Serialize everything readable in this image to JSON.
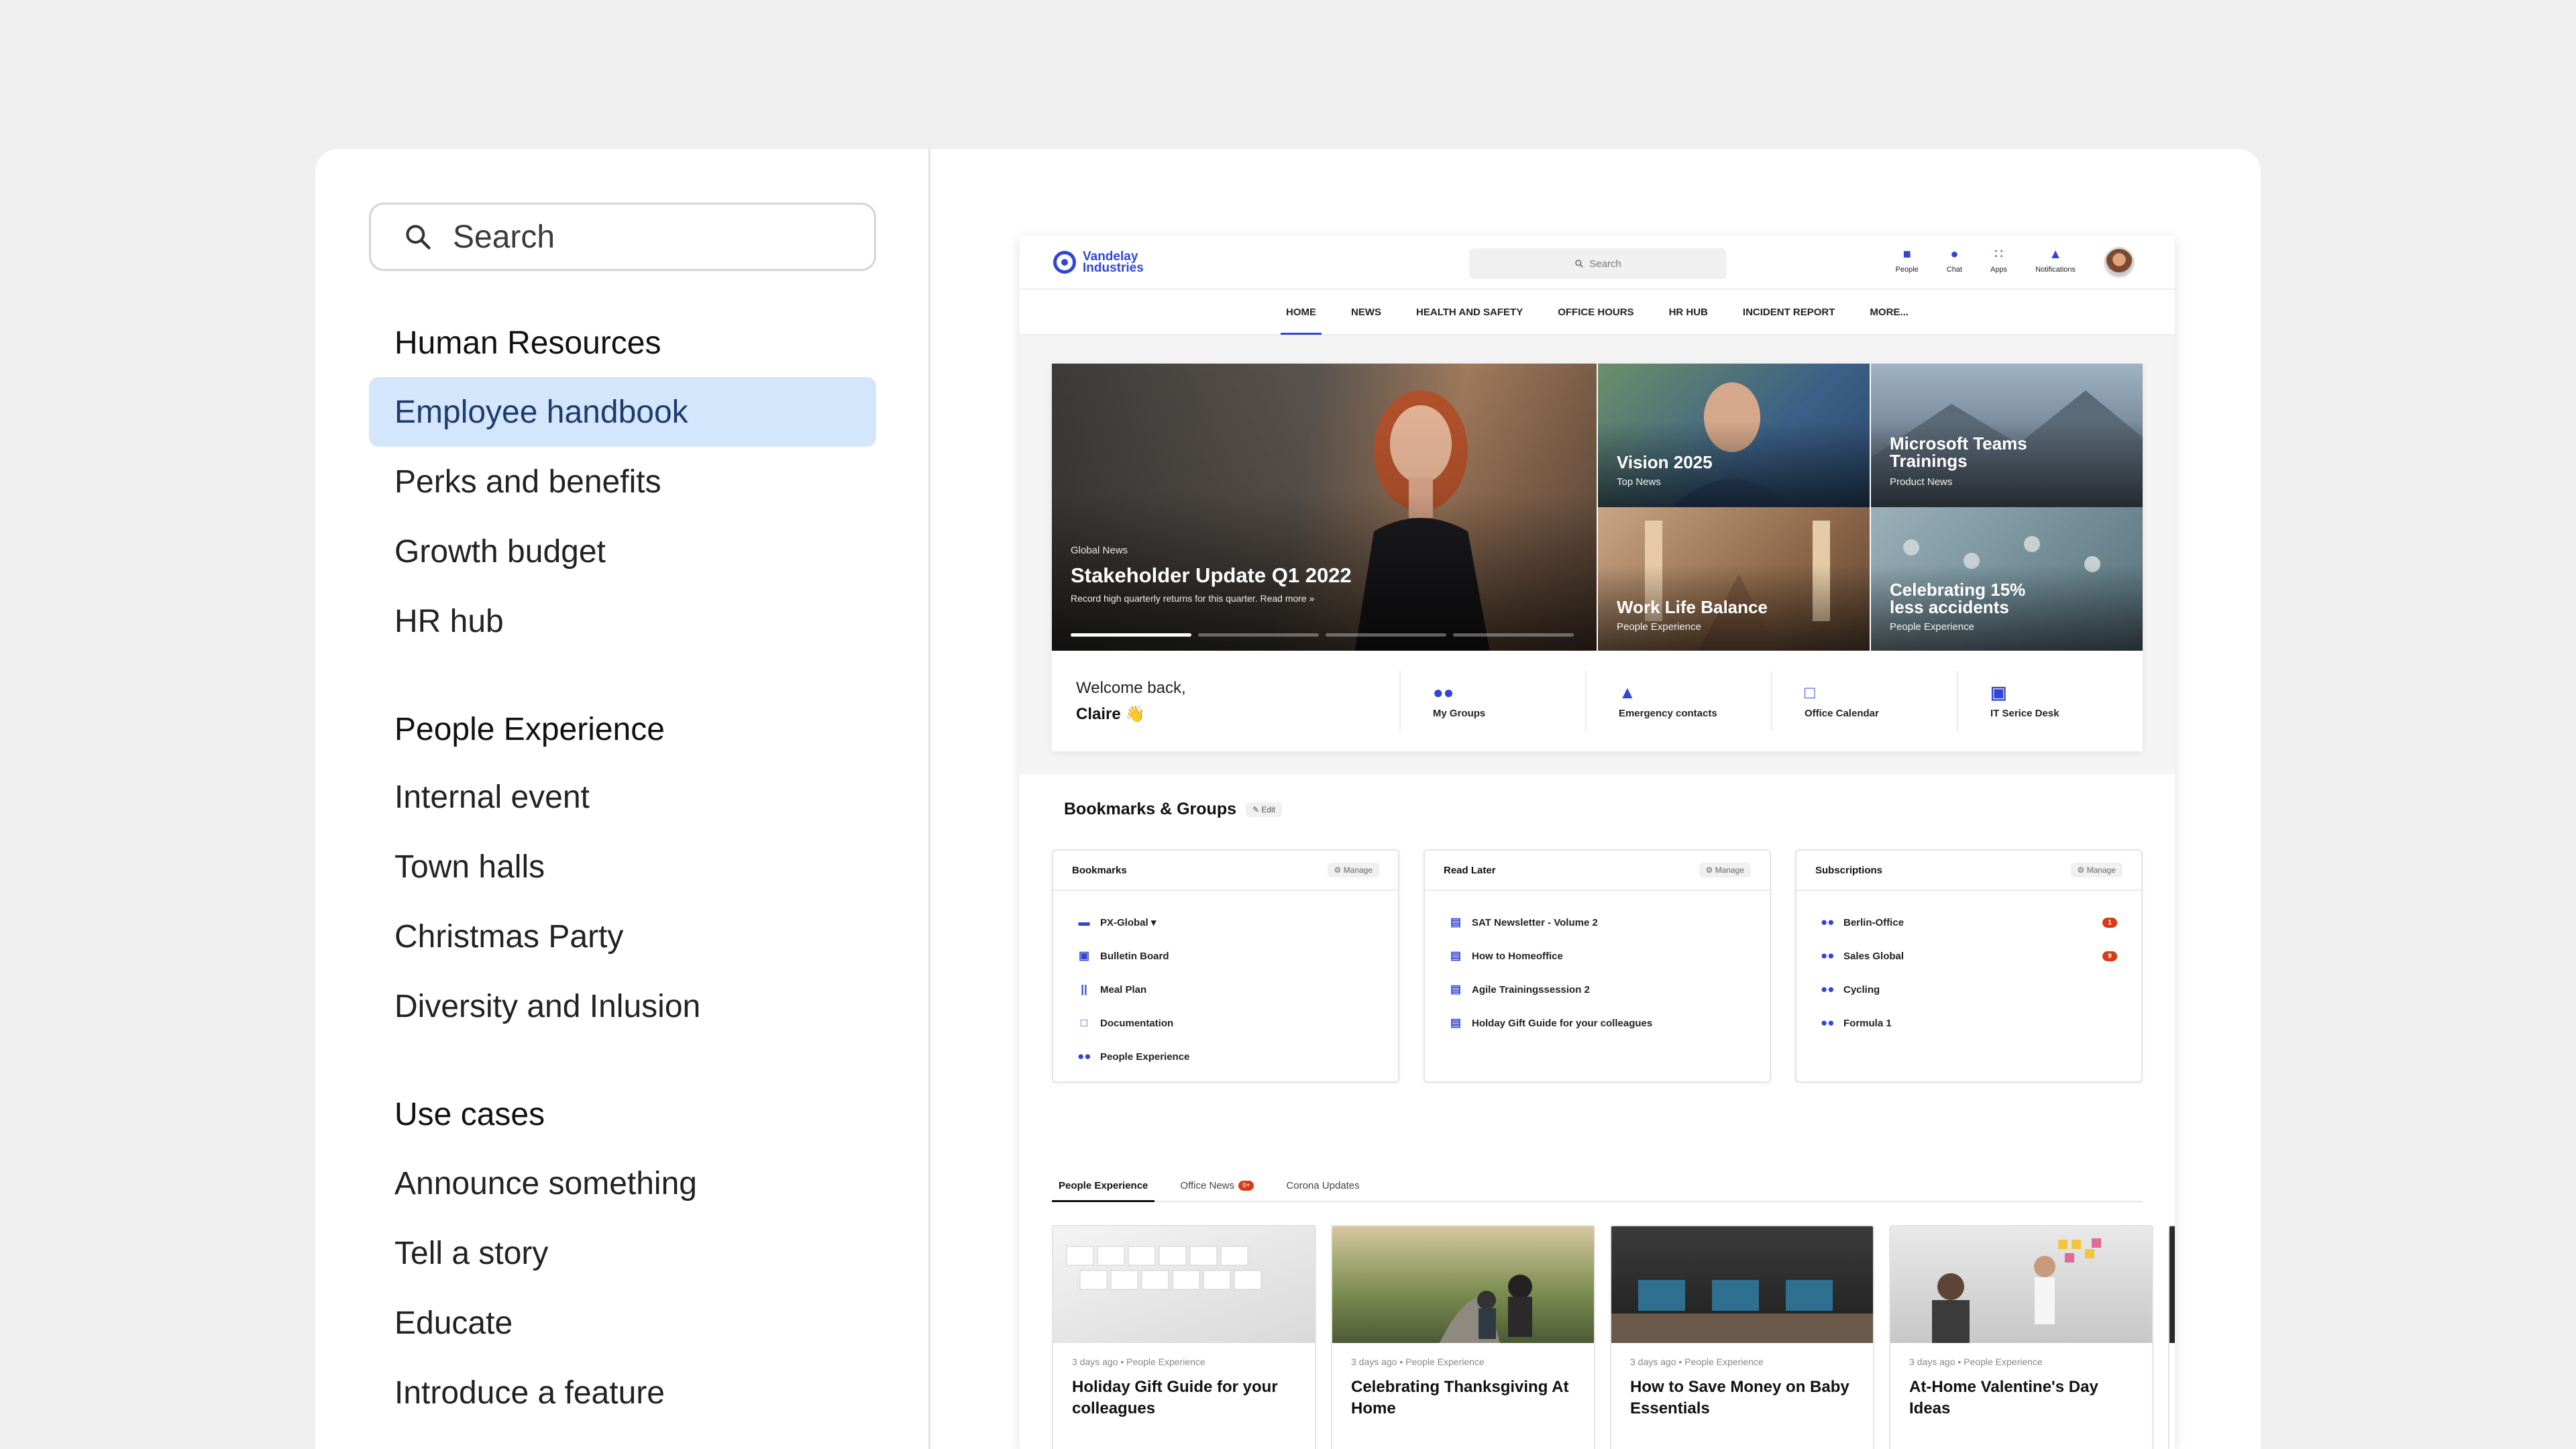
{
  "sidebar": {
    "search_placeholder": "Search",
    "sections": [
      {
        "title": "Human Resources",
        "items": [
          "Employee handbook",
          "Perks and benefits",
          "Growth budget",
          "HR hub"
        ]
      },
      {
        "title": "People Experience",
        "items": [
          "Internal event",
          "Town halls",
          "Christmas Party",
          "Diversity and Inlusion"
        ]
      },
      {
        "title": "Use cases",
        "items": [
          "Announce something",
          "Tell a story",
          "Educate",
          "Introduce a feature"
        ]
      }
    ]
  },
  "mock": {
    "logo_line1": "Vandelay",
    "logo_line2": "Industries",
    "search": "Search",
    "top_icons": [
      "People",
      "Chat",
      "Apps",
      "Notifications"
    ],
    "menu": [
      "HOME",
      "NEWS",
      "HEALTH AND SAFETY",
      "OFFICE HOURS",
      "HR HUB",
      "INCIDENT REPORT",
      "MORE..."
    ],
    "hero": {
      "category": "Global News",
      "title": "Stakeholder Update Q1 2022",
      "subtitle": "Record high quarterly returns for this quarter. Read more »"
    },
    "tiles": [
      {
        "title": "Vision 2025",
        "sub": "Top News"
      },
      {
        "title_line1": "Microsoft Teams",
        "title_line2": "Trainings",
        "sub": "Product News"
      },
      {
        "title": "Work Life Balance",
        "sub": "People Experience"
      },
      {
        "title_line1": "Celebrating 15%",
        "title_line2": "less accidents",
        "sub": "People Experience"
      }
    ],
    "welcome_line1": "Welcome back,",
    "welcome_name": "Claire 👋",
    "quick_links": [
      "My Groups",
      "Emergency contacts",
      "Office Calendar",
      "IT Serice Desk"
    ],
    "bookmarks_title": "Bookmarks & Groups",
    "edit": "✎ Edit",
    "manage": "⚙ Manage",
    "cards": {
      "bookmarks": {
        "title": "Bookmarks",
        "items": [
          "PX-Global ▾",
          "Bulletin Board",
          "Meal Plan",
          "Documentation",
          "People Experience"
        ]
      },
      "read_later": {
        "title": "Read Later",
        "items": [
          "SAT Newsletter - Volume 2",
          "How to Homeoffice",
          "Agile Trainingssession 2",
          "Holday Gift Guide for your colleagues"
        ]
      },
      "subscriptions": {
        "title": "Subscriptions",
        "items": [
          "Berlin-Office",
          "Sales Global",
          "Cycling",
          "Formula 1"
        ],
        "badges": [
          "1",
          "9"
        ]
      }
    },
    "tabs": [
      "People Experience",
      "Office News",
      "Corona Updates"
    ],
    "tab_badge": "9+",
    "news": [
      {
        "meta": "3 days ago • People Experience",
        "title": "Holiday Gift Guide for your colleagues"
      },
      {
        "meta": "3 days ago • People Experience",
        "title": "Celebrating Thanksgiving At Home"
      },
      {
        "meta": "3 days ago • People Experience",
        "title": "How to Save Money on Baby Essentials"
      },
      {
        "meta": "3 days ago • People Experience",
        "title": "At-Home Valentine's Day Ideas"
      }
    ]
  },
  "colors": {
    "accent": "#3346d3",
    "active_bg": "#d4e6fb",
    "badge": "#d83a16"
  }
}
